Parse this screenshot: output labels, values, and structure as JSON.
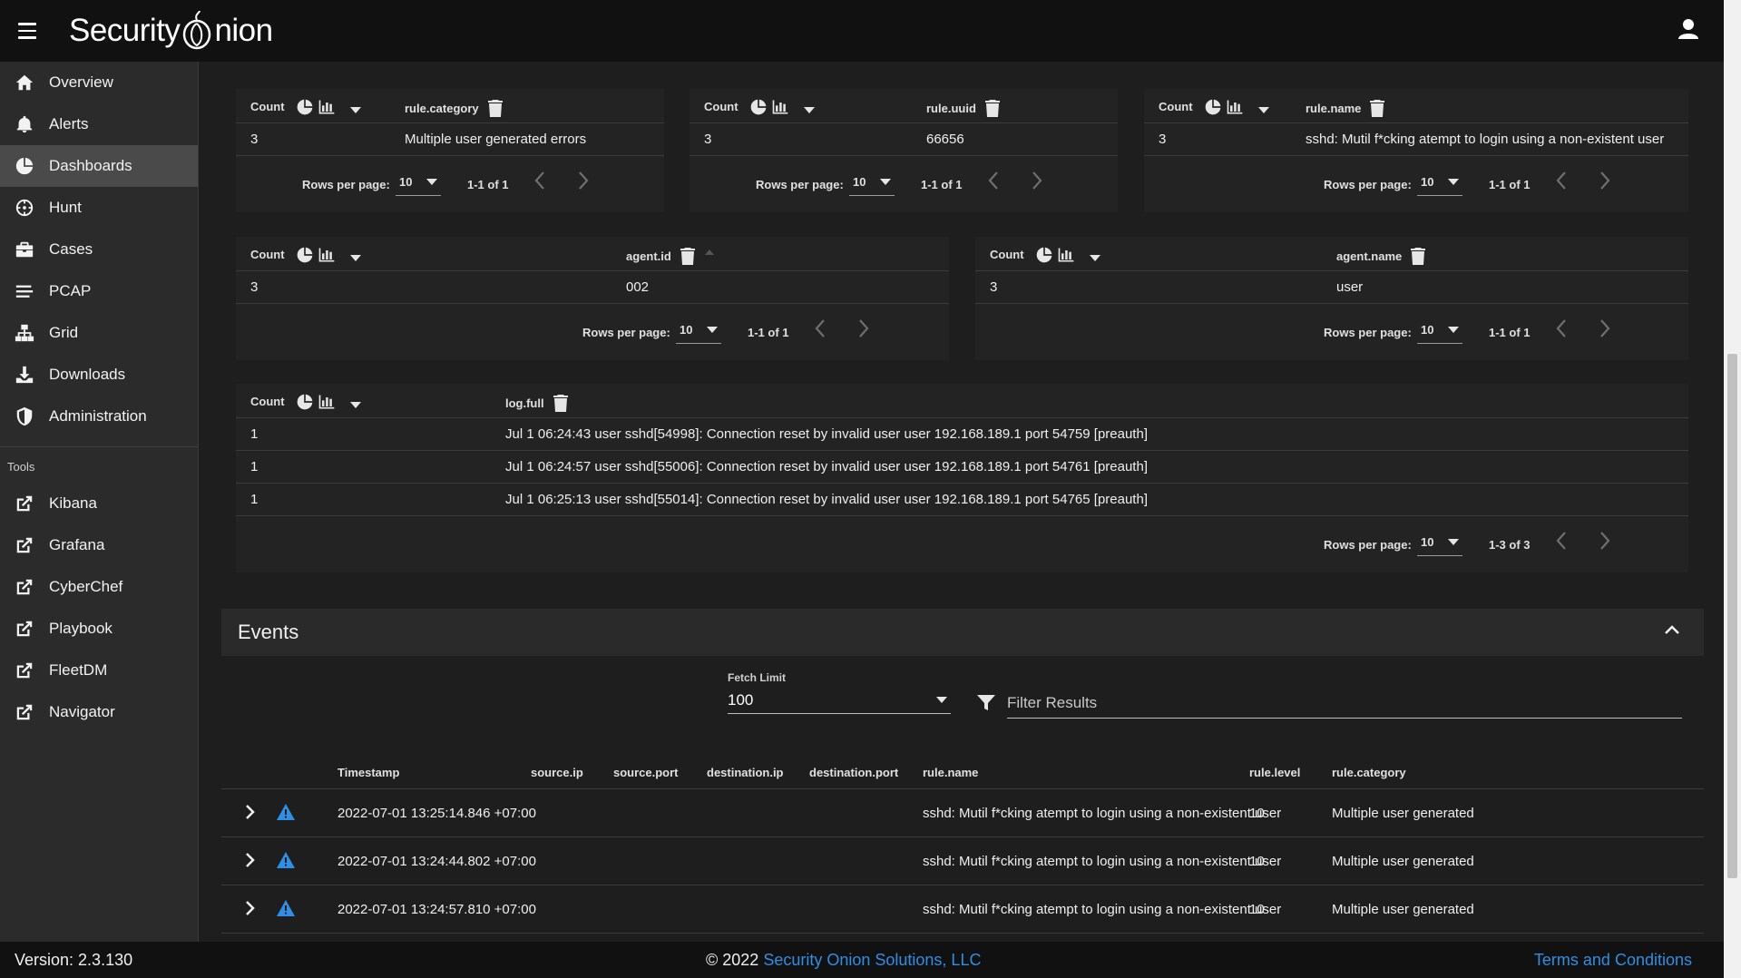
{
  "app": {
    "title_part1": "Security",
    "title_part2": "nion"
  },
  "sidebar": {
    "items": [
      {
        "label": "Overview",
        "icon": "home-icon"
      },
      {
        "label": "Alerts",
        "icon": "bell-icon"
      },
      {
        "label": "Dashboards",
        "icon": "pie-chart-icon"
      },
      {
        "label": "Hunt",
        "icon": "crosshairs-icon"
      },
      {
        "label": "Cases",
        "icon": "briefcase-icon"
      },
      {
        "label": "PCAP",
        "icon": "stream-icon"
      },
      {
        "label": "Grid",
        "icon": "sitemap-icon"
      },
      {
        "label": "Downloads",
        "icon": "download-icon"
      },
      {
        "label": "Administration",
        "icon": "shield-icon"
      }
    ],
    "tools_label": "Tools",
    "tools": [
      {
        "label": "Kibana",
        "icon": "external-link-icon"
      },
      {
        "label": "Grafana",
        "icon": "external-link-icon"
      },
      {
        "label": "CyberChef",
        "icon": "external-link-icon"
      },
      {
        "label": "Playbook",
        "icon": "external-link-icon"
      },
      {
        "label": "FleetDM",
        "icon": "external-link-icon"
      },
      {
        "label": "Navigator",
        "icon": "external-link-icon"
      }
    ]
  },
  "common": {
    "count": "Count",
    "rows_per_page": "Rows per page:",
    "rpp_value": "10"
  },
  "cards": {
    "rule_category": {
      "field": "rule.category",
      "count": "3",
      "value": "Multiple user generated errors",
      "range": "1-1 of 1"
    },
    "rule_uuid": {
      "field": "rule.uuid",
      "count": "3",
      "value": "66656",
      "range": "1-1 of 1"
    },
    "rule_name": {
      "field": "rule.name",
      "count": "3",
      "value": "sshd: Mutil f*cking atempt to login using a non-existent user",
      "range": "1-1 of 1"
    },
    "agent_id": {
      "field": "agent.id",
      "count": "3",
      "value": "002",
      "range": "1-1 of 1"
    },
    "agent_name": {
      "field": "agent.name",
      "count": "3",
      "value": "user",
      "range": "1-1 of 1"
    },
    "log_full": {
      "field": "log.full",
      "rows": [
        {
          "count": "1",
          "value": "Jul 1 06:24:43 user sshd[54998]: Connection reset by invalid user user 192.168.189.1 port 54759 [preauth]"
        },
        {
          "count": "1",
          "value": "Jul 1 06:24:57 user sshd[55006]: Connection reset by invalid user user 192.168.189.1 port 54761 [preauth]"
        },
        {
          "count": "1",
          "value": "Jul 1 06:25:13 user sshd[55014]: Connection reset by invalid user user 192.168.189.1 port 54765 [preauth]"
        }
      ],
      "range": "1-3 of 3"
    }
  },
  "events": {
    "title": "Events",
    "fetch_label": "Fetch Limit",
    "fetch_value": "100",
    "filter_placeholder": "Filter Results",
    "columns": [
      "Timestamp",
      "source.ip",
      "source.port",
      "destination.ip",
      "destination.port",
      "rule.name",
      "rule.level",
      "rule.category"
    ],
    "rows": [
      {
        "timestamp": "2022-07-01 13:25:14.846 +07:00",
        "rule_name": "sshd: Mutil f*cking atempt to login using a non-existent user",
        "rule_level": "10",
        "rule_category": "Multiple user generated"
      },
      {
        "timestamp": "2022-07-01 13:24:44.802 +07:00",
        "rule_name": "sshd: Mutil f*cking atempt to login using a non-existent user",
        "rule_level": "10",
        "rule_category": "Multiple user generated"
      },
      {
        "timestamp": "2022-07-01 13:24:57.810 +07:00",
        "rule_name": "sshd: Mutil f*cking atempt to login using a non-existent user",
        "rule_level": "10",
        "rule_category": "Multiple user generated"
      }
    ]
  },
  "footer": {
    "version": "Version: 2.3.130",
    "copyright": "© 2022",
    "company": "Security Onion Solutions, LLC",
    "terms": "Terms and Conditions"
  },
  "colors": {
    "accent": "#2f8ee5",
    "topbar": "#111111",
    "sidebar": "#2b2b2b",
    "background": "#1e1e1e"
  }
}
